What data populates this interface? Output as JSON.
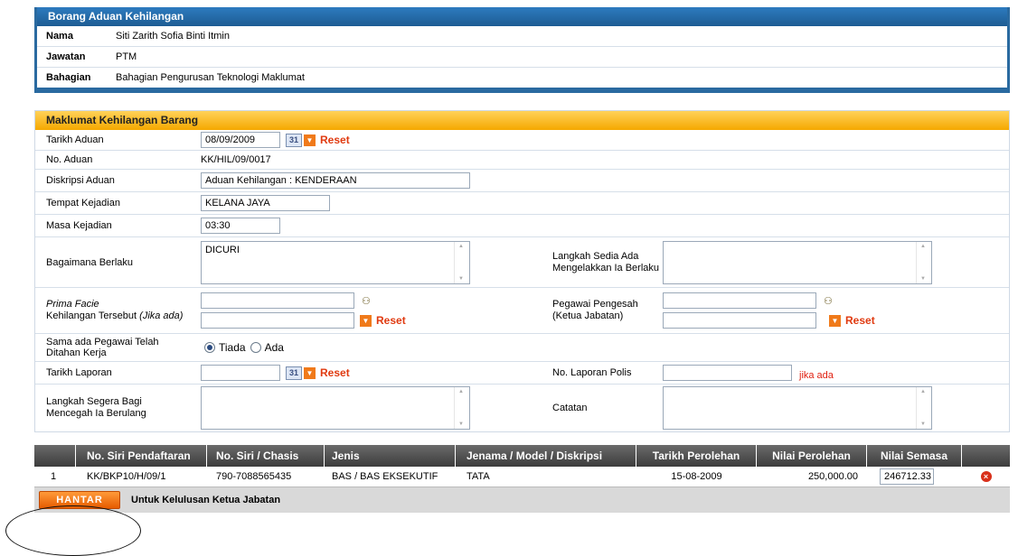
{
  "personal": {
    "title": "Borang Aduan Kehilangan",
    "rows": [
      {
        "label": "Nama",
        "value": "Siti Zarith Sofia Binti Itmin"
      },
      {
        "label": "Jawatan",
        "value": "PTM"
      },
      {
        "label": "Bahagian",
        "value": "Bahagian Pengurusan Teknologi Maklumat"
      }
    ]
  },
  "form": {
    "title": "Maklumat Kehilangan Barang",
    "tarikh_aduan_label": "Tarikh Aduan",
    "tarikh_aduan_value": "08/09/2009",
    "reset": "Reset",
    "no_aduan_label": "No. Aduan",
    "no_aduan_value": "KK/HIL/09/0017",
    "diskripsi_label": "Diskripsi Aduan",
    "diskripsi_value": "Aduan Kehilangan : KENDERAAN",
    "tempat_label": "Tempat Kejadian",
    "tempat_value": "KELANA JAYA",
    "masa_label": "Masa Kejadian",
    "masa_value": "03:30",
    "bagaimana_label": "Bagaimana Berlaku",
    "bagaimana_value": "DICURI",
    "langkah_sedia_label_1": "Langkah Sedia Ada",
    "langkah_sedia_label_2": "Mengelakkan Ia Berlaku",
    "prima_facie_label_1": "Prima Facie",
    "prima_facie_label_2a": "Kehilangan Tersebut ",
    "prima_facie_label_2b": "(Jika ada)",
    "pegawai_pengesah_label_1": "Pegawai Pengesah",
    "pegawai_pengesah_label_2": "(Ketua Jabatan)",
    "sama_ada_label_1": "Sama ada Pegawai Telah",
    "sama_ada_label_2": "Ditahan Kerja",
    "radio_tiada": "Tiada",
    "radio_ada": "Ada",
    "tarikh_laporan_label": "Tarikh Laporan",
    "no_laporan_polis_label": "No. Laporan Polis",
    "jika_ada": "jika ada",
    "langkah_segera_label_1": "Langkah Segera Bagi",
    "langkah_segera_label_2": "Mencegah Ia Berulang",
    "catatan_label": "Catatan",
    "cal_text": "31"
  },
  "table": {
    "headers": [
      "",
      "No. Siri Pendaftaran",
      "No. Siri / Chasis",
      "Jenis",
      "Jenama / Model / Diskripsi",
      "Tarikh Perolehan",
      "Nilai Perolehan",
      "Nilai Semasa",
      ""
    ],
    "row": {
      "no": "1",
      "siri_pendaftaran": "KK/BKP10/H/09/1",
      "chasis": "790-7088565435",
      "jenis": "BAS / BAS EKSEKUTIF",
      "jenama": "TATA",
      "tarikh": "15-08-2009",
      "nilai_perolehan": "250,000.00",
      "nilai_semasa": "246712.33"
    }
  },
  "footer": {
    "button": "HANTAR",
    "note": "Untuk Kelulusan Ketua Jabatan"
  },
  "colors": {
    "header_blue": "#2a6aa0",
    "section_orange": "#f5a800",
    "reset_red": "#e03a10",
    "button_orange": "#e65c00"
  },
  "icons": [
    "calendar-icon",
    "dropdown-arrow-icon",
    "person-lookup-icon",
    "delete-icon"
  ]
}
